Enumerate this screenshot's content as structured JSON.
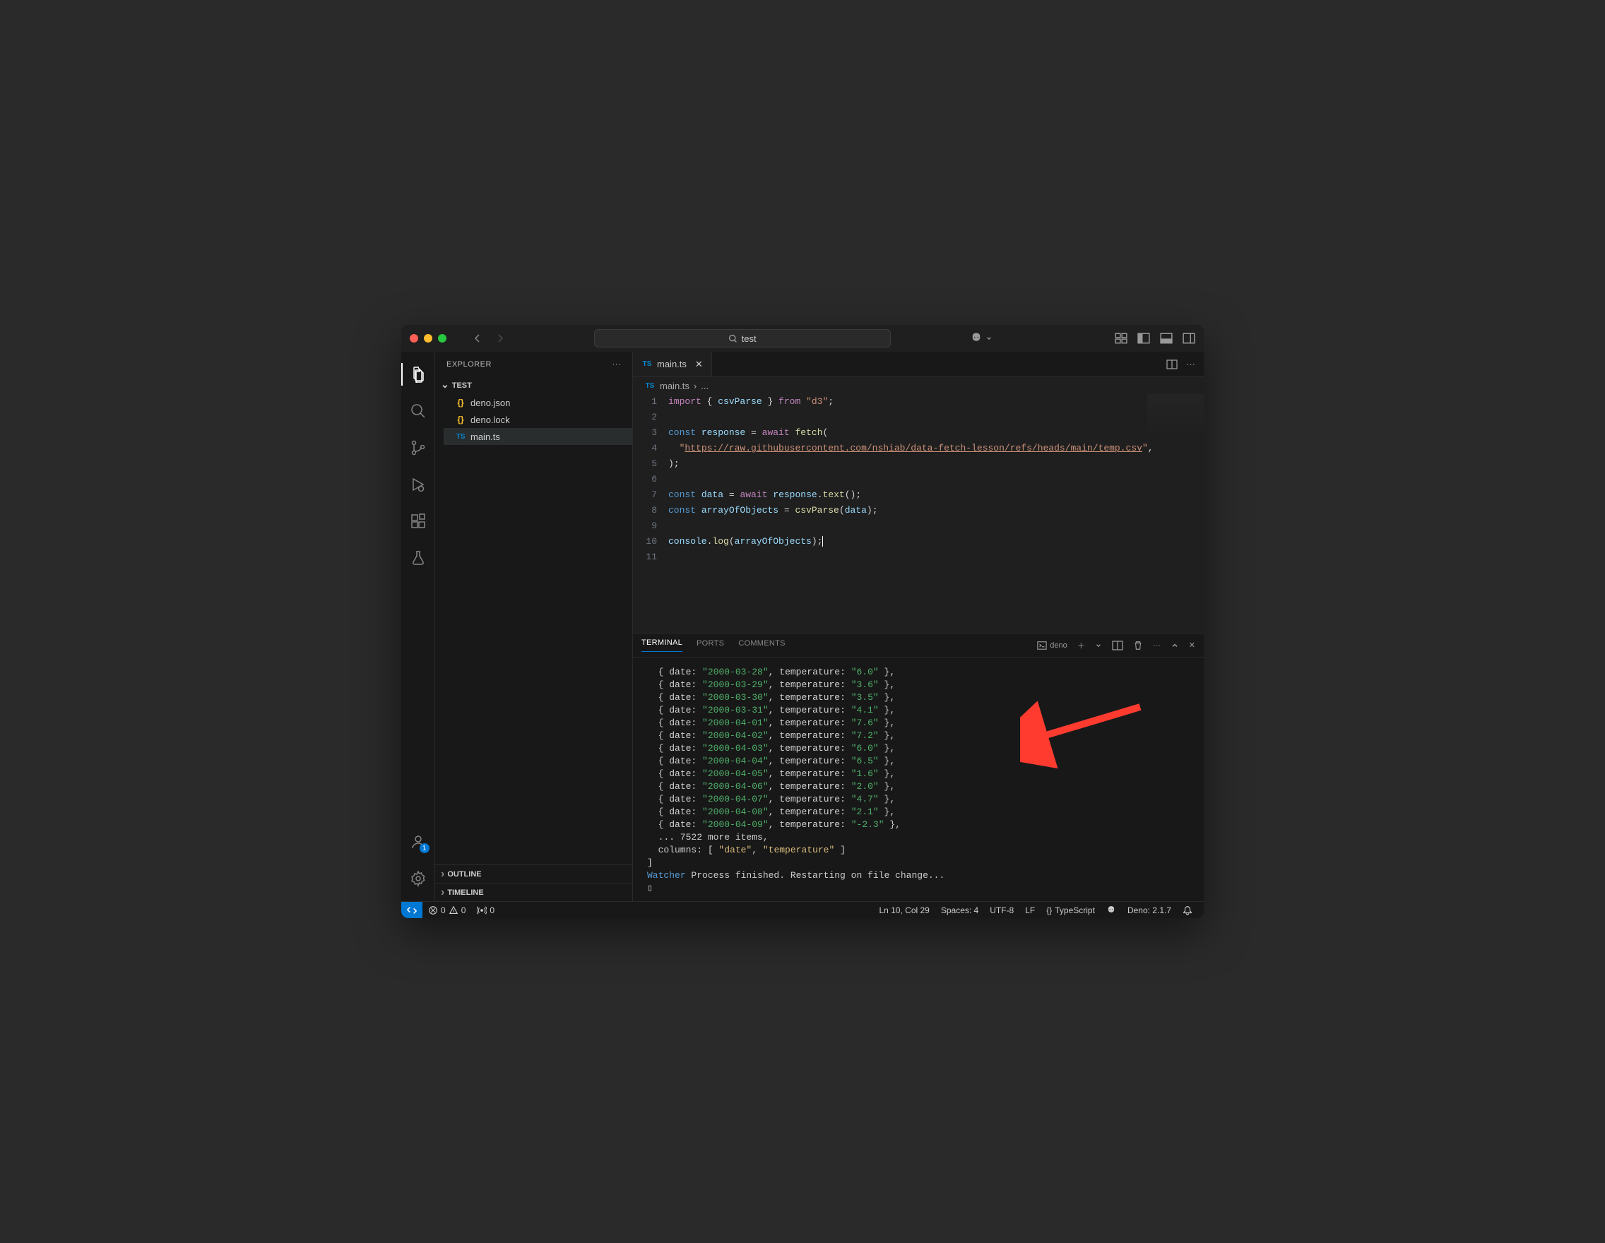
{
  "titlebar": {
    "search_text": "test"
  },
  "sidebar": {
    "title": "EXPLORER",
    "folder_name": "TEST",
    "files": [
      {
        "name": "deno.json",
        "icon": "json"
      },
      {
        "name": "deno.lock",
        "icon": "json"
      },
      {
        "name": "main.ts",
        "icon": "ts",
        "selected": true
      }
    ],
    "sections": [
      "OUTLINE",
      "TIMELINE"
    ]
  },
  "tabs": {
    "active": {
      "name": "main.ts",
      "icon": "ts"
    }
  },
  "breadcrumb": {
    "file": "main.ts",
    "separator": "›",
    "more": "..."
  },
  "code": {
    "lines": [
      {
        "n": 1,
        "tokens": [
          {
            "t": "import",
            "c": "kw-import"
          },
          {
            "t": " { ",
            "c": "punct"
          },
          {
            "t": "csvParse",
            "c": "var"
          },
          {
            "t": " } ",
            "c": "punct"
          },
          {
            "t": "from",
            "c": "kw-from"
          },
          {
            "t": " ",
            "c": ""
          },
          {
            "t": "\"d3\"",
            "c": "str"
          },
          {
            "t": ";",
            "c": "punct"
          }
        ]
      },
      {
        "n": 2,
        "tokens": []
      },
      {
        "n": 3,
        "tokens": [
          {
            "t": "const",
            "c": "kw-const"
          },
          {
            "t": " ",
            "c": ""
          },
          {
            "t": "response",
            "c": "var"
          },
          {
            "t": " = ",
            "c": "punct"
          },
          {
            "t": "await",
            "c": "kw-await"
          },
          {
            "t": " ",
            "c": ""
          },
          {
            "t": "fetch",
            "c": "fn"
          },
          {
            "t": "(",
            "c": "punct"
          }
        ]
      },
      {
        "n": 4,
        "tokens": [
          {
            "t": "  ",
            "c": ""
          },
          {
            "t": "\"",
            "c": "str"
          },
          {
            "t": "https://raw.githubusercontent.com/nshiab/data-fetch-lesson/refs/heads/main/temp.csv",
            "c": "url-str"
          },
          {
            "t": "\"",
            "c": "str"
          },
          {
            "t": ",",
            "c": "punct"
          }
        ]
      },
      {
        "n": 5,
        "tokens": [
          {
            "t": ");",
            "c": "punct"
          }
        ]
      },
      {
        "n": 6,
        "tokens": []
      },
      {
        "n": 7,
        "tokens": [
          {
            "t": "const",
            "c": "kw-const"
          },
          {
            "t": " ",
            "c": ""
          },
          {
            "t": "data",
            "c": "var"
          },
          {
            "t": " = ",
            "c": "punct"
          },
          {
            "t": "await",
            "c": "kw-await"
          },
          {
            "t": " ",
            "c": ""
          },
          {
            "t": "response",
            "c": "var"
          },
          {
            "t": ".",
            "c": "punct"
          },
          {
            "t": "text",
            "c": "fn"
          },
          {
            "t": "();",
            "c": "punct"
          }
        ]
      },
      {
        "n": 8,
        "tokens": [
          {
            "t": "const",
            "c": "kw-const"
          },
          {
            "t": " ",
            "c": ""
          },
          {
            "t": "arrayOfObjects",
            "c": "var"
          },
          {
            "t": " = ",
            "c": "punct"
          },
          {
            "t": "csvParse",
            "c": "fn"
          },
          {
            "t": "(",
            "c": "punct"
          },
          {
            "t": "data",
            "c": "var"
          },
          {
            "t": ");",
            "c": "punct"
          }
        ]
      },
      {
        "n": 9,
        "tokens": []
      },
      {
        "n": 10,
        "tokens": [
          {
            "t": "console",
            "c": "var"
          },
          {
            "t": ".",
            "c": "punct"
          },
          {
            "t": "log",
            "c": "fn"
          },
          {
            "t": "(",
            "c": "punct"
          },
          {
            "t": "arrayOfObjects",
            "c": "var"
          },
          {
            "t": ");",
            "c": "punct"
          }
        ]
      },
      {
        "n": 11,
        "tokens": []
      }
    ]
  },
  "panel": {
    "tabs": [
      "TERMINAL",
      "PORTS",
      "COMMENTS"
    ],
    "active_tab": "TERMINAL",
    "shell": "deno",
    "output_rows": [
      {
        "date": "2000-03-28",
        "temperature": "6.0"
      },
      {
        "date": "2000-03-29",
        "temperature": "3.6"
      },
      {
        "date": "2000-03-30",
        "temperature": "3.5"
      },
      {
        "date": "2000-03-31",
        "temperature": "4.1"
      },
      {
        "date": "2000-04-01",
        "temperature": "7.6"
      },
      {
        "date": "2000-04-02",
        "temperature": "7.2"
      },
      {
        "date": "2000-04-03",
        "temperature": "6.0"
      },
      {
        "date": "2000-04-04",
        "temperature": "6.5"
      },
      {
        "date": "2000-04-05",
        "temperature": "1.6"
      },
      {
        "date": "2000-04-06",
        "temperature": "2.0"
      },
      {
        "date": "2000-04-07",
        "temperature": "4.7"
      },
      {
        "date": "2000-04-08",
        "temperature": "2.1"
      },
      {
        "date": "2000-04-09",
        "temperature": "-2.3"
      }
    ],
    "more_items": "... 7522 more items,",
    "columns_line_prefix": "columns: [ ",
    "columns": [
      "date",
      "temperature"
    ],
    "columns_line_suffix": " ]",
    "closing_bracket": "]",
    "watcher_label": "Watcher",
    "watcher_text": " Process finished. Restarting on file change...",
    "cursor": "▯"
  },
  "status": {
    "errors": "0",
    "warnings": "0",
    "ports": "0",
    "cursor_pos": "Ln 10, Col 29",
    "spaces": "Spaces: 4",
    "encoding": "UTF-8",
    "eol": "LF",
    "lang_icon": "{}",
    "language": "TypeScript",
    "runtime": "Deno: 2.1.7"
  },
  "accounts_badge": "1"
}
